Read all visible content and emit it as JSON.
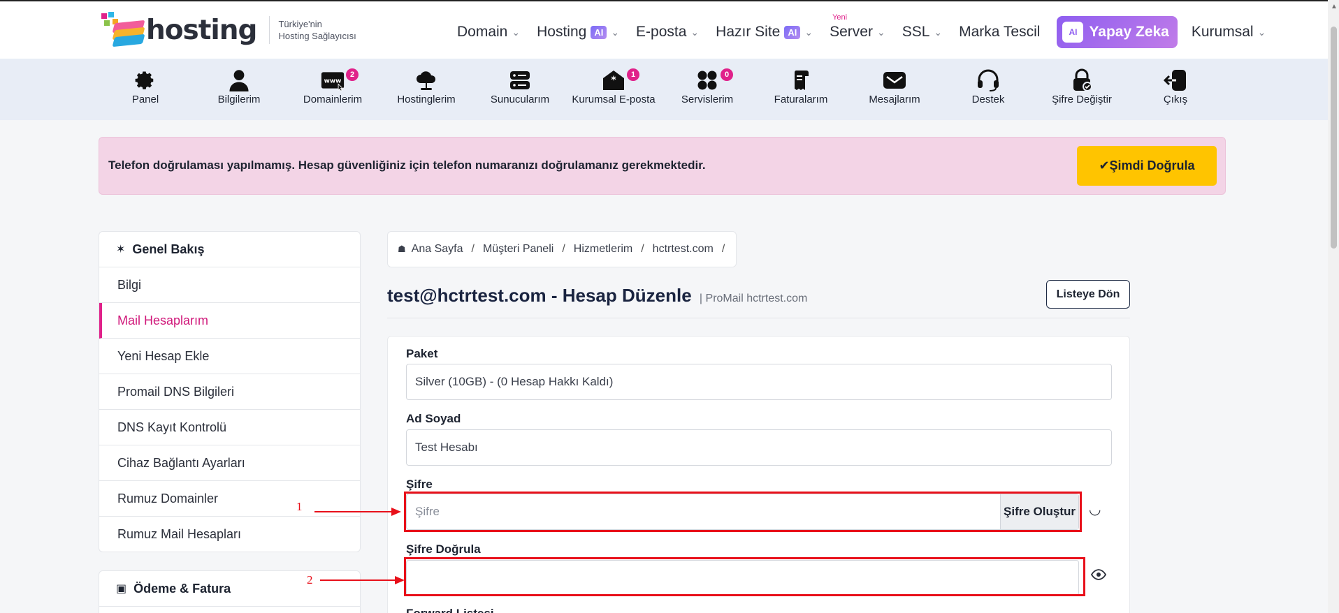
{
  "brand": {
    "logo_text": "hosting",
    "tagline_line1": "Türkiye'nin",
    "tagline_line2": "Hosting Sağlayıcısı"
  },
  "main_nav": {
    "domain": "Domain",
    "hosting": "Hosting",
    "eposta": "E-posta",
    "hazir_site": "Hazır Site",
    "server": "Server",
    "server_badge": "Yeni",
    "ssl": "SSL",
    "marka": "Marka Tescil",
    "ai_button": "Yapay Zeka",
    "ai_badge": "AI",
    "kurumsal": "Kurumsal"
  },
  "icon_bar": [
    {
      "label": "Panel",
      "icon": "gear-icon"
    },
    {
      "label": "Bilgilerim",
      "icon": "user-icon"
    },
    {
      "label": "Domainlerim",
      "icon": "www-icon",
      "count": "2"
    },
    {
      "label": "Hostinglerim",
      "icon": "cloud-icon"
    },
    {
      "label": "Sunucularım",
      "icon": "server-icon"
    },
    {
      "label": "Kurumsal E-posta",
      "icon": "mail-open-icon",
      "count": "1"
    },
    {
      "label": "Servislerim",
      "icon": "grid-icon",
      "count": "0"
    },
    {
      "label": "Faturalarım",
      "icon": "invoice-icon"
    },
    {
      "label": "Mesajlarım",
      "icon": "envelope-icon"
    },
    {
      "label": "Destek",
      "icon": "headset-icon"
    },
    {
      "label": "Şifre Değiştir",
      "icon": "lock-icon"
    },
    {
      "label": "Çıkış",
      "icon": "logout-icon"
    }
  ],
  "alert": {
    "text": "Telefon doğrulaması yapılmamış. Hesap güvenliğiniz için telefon numaranızı doğrulamanız gerekmektedir.",
    "button": "Şimdi Doğrula"
  },
  "sidebar": {
    "section1_title": "Genel Bakış",
    "items": [
      "Bilgi",
      "Mail Hesaplarım",
      "Yeni Hesap Ekle",
      "Promail DNS Bilgileri",
      "DNS Kayıt Kontrolü",
      "Cihaz Bağlantı Ayarları",
      "Rumuz Domainler",
      "Rumuz Mail Hesapları"
    ],
    "active_item": "Mail Hesaplarım",
    "section2_title": "Ödeme & Fatura"
  },
  "breadcrumb": [
    "Ana Sayfa",
    "Müşteri Paneli",
    "Hizmetlerim",
    "hctrtest.com"
  ],
  "page": {
    "title": "test@hctrtest.com - Hesap Düzenle",
    "subtitle": "| ProMail hctrtest.com",
    "back_button": "Listeye Dön"
  },
  "form": {
    "paket_label": "Paket",
    "paket_value": "Silver (10GB) - (0 Hesap Hakkı Kaldı)",
    "adsoyad_label": "Ad Soyad",
    "adsoyad_value": "Test Hesabı",
    "sifre_label": "Şifre",
    "sifre_placeholder": "Şifre",
    "sifre_button": "Şifre Oluştur",
    "sifre_dogrula_label": "Şifre Doğrula",
    "forward_label": "Forward Listesi"
  },
  "annotations": {
    "marker1": "1",
    "marker2": "2",
    "color": "#e8101a"
  },
  "colors": {
    "accent_pink": "#e0218a",
    "alert_bg": "#f3d4e6",
    "verify_yellow": "#ffc400",
    "iconbar_bg": "#e8edf6"
  }
}
